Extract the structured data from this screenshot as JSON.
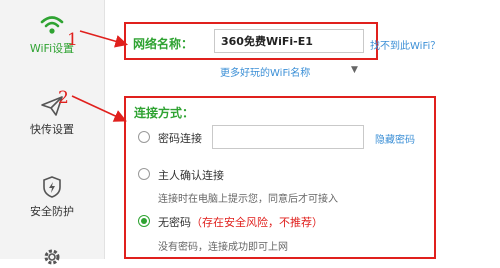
{
  "sidebar": {
    "items": [
      {
        "label": "WiFi设置",
        "icon": "wifi-icon",
        "active": true
      },
      {
        "label": "快传设置",
        "icon": "paper-plane-icon",
        "active": false
      },
      {
        "label": "安全防护",
        "icon": "shield-bolt-icon",
        "active": false
      },
      {
        "label": "",
        "icon": "gear-icon",
        "active": false
      }
    ]
  },
  "annotations": {
    "marker1": "1",
    "marker2": "2"
  },
  "network": {
    "name_label": "网络名称：",
    "ssid_value": "360免费WiFi-E1",
    "hint_link": "找不到此WiFi？",
    "more_names_link": "更多好玩的WiFi名称",
    "more_caret": "▼"
  },
  "connection": {
    "title": "连接方式：",
    "options": [
      {
        "label": "密码连接",
        "checked": false
      },
      {
        "label": "主人确认连接",
        "checked": false,
        "description": "连接时在电脑上提示您，同意后才可接入"
      },
      {
        "label": "无密码",
        "warning": "（存在安全风险，不推荐）",
        "checked": true,
        "description": "没有密码，连接成功即可上网"
      }
    ],
    "password_value": "",
    "hide_password_link": "隐藏密码"
  },
  "colors": {
    "accent_green": "#2fa332",
    "annotation_red": "#e0201d",
    "link_blue": "#3b8fd6"
  }
}
